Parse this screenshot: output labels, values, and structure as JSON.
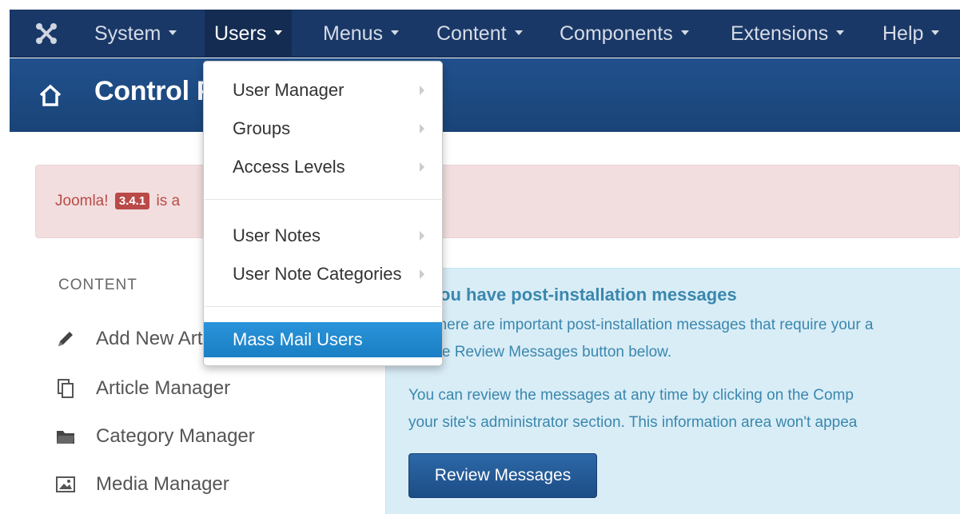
{
  "navbar": {
    "menus": [
      {
        "label": "System"
      },
      {
        "label": "Users"
      },
      {
        "label": "Menus"
      },
      {
        "label": "Content"
      },
      {
        "label": "Components"
      },
      {
        "label": "Extensions"
      },
      {
        "label": "Help"
      }
    ],
    "logo_icon": "joomla-logo-icon"
  },
  "titlebar": {
    "title": "Control Panel",
    "icon": "home-icon"
  },
  "users_menu": {
    "items": [
      {
        "label": "User Manager",
        "has_submenu": true
      },
      {
        "label": "Groups",
        "has_submenu": true
      },
      {
        "label": "Access Levels",
        "has_submenu": true
      },
      {
        "label": "User Notes",
        "has_submenu": true
      },
      {
        "label": "User Note Categories",
        "has_submenu": true
      },
      {
        "label": "Mass Mail Users",
        "has_submenu": false,
        "highlighted": true
      }
    ]
  },
  "alert": {
    "prefix": "Joomla!",
    "version": "3.4.1",
    "suffix": "is a"
  },
  "sidebar": {
    "heading": "CONTENT",
    "items": [
      {
        "label": "Add New Article",
        "icon": "pencil-icon"
      },
      {
        "label": "Article Manager",
        "icon": "copy-icon"
      },
      {
        "label": "Category Manager",
        "icon": "folder-icon"
      },
      {
        "label": "Media Manager",
        "icon": "image-icon"
      }
    ]
  },
  "info": {
    "heading": "You have post-installation messages",
    "line1": "There are important post-installation messages that require your a",
    "line2": "the Review Messages button below.",
    "line3": "You can review the messages at any time by clicking on the Comp",
    "line4": "your site's administrator section. This information area won't appea",
    "button": "Review Messages"
  },
  "colors": {
    "navbar_bg": "#1a3867",
    "titlebar_bg": "#1d4a82",
    "menu_highlight": "#1f8dd6",
    "alert_bg": "#f2dede",
    "info_bg": "#d9edf7"
  }
}
